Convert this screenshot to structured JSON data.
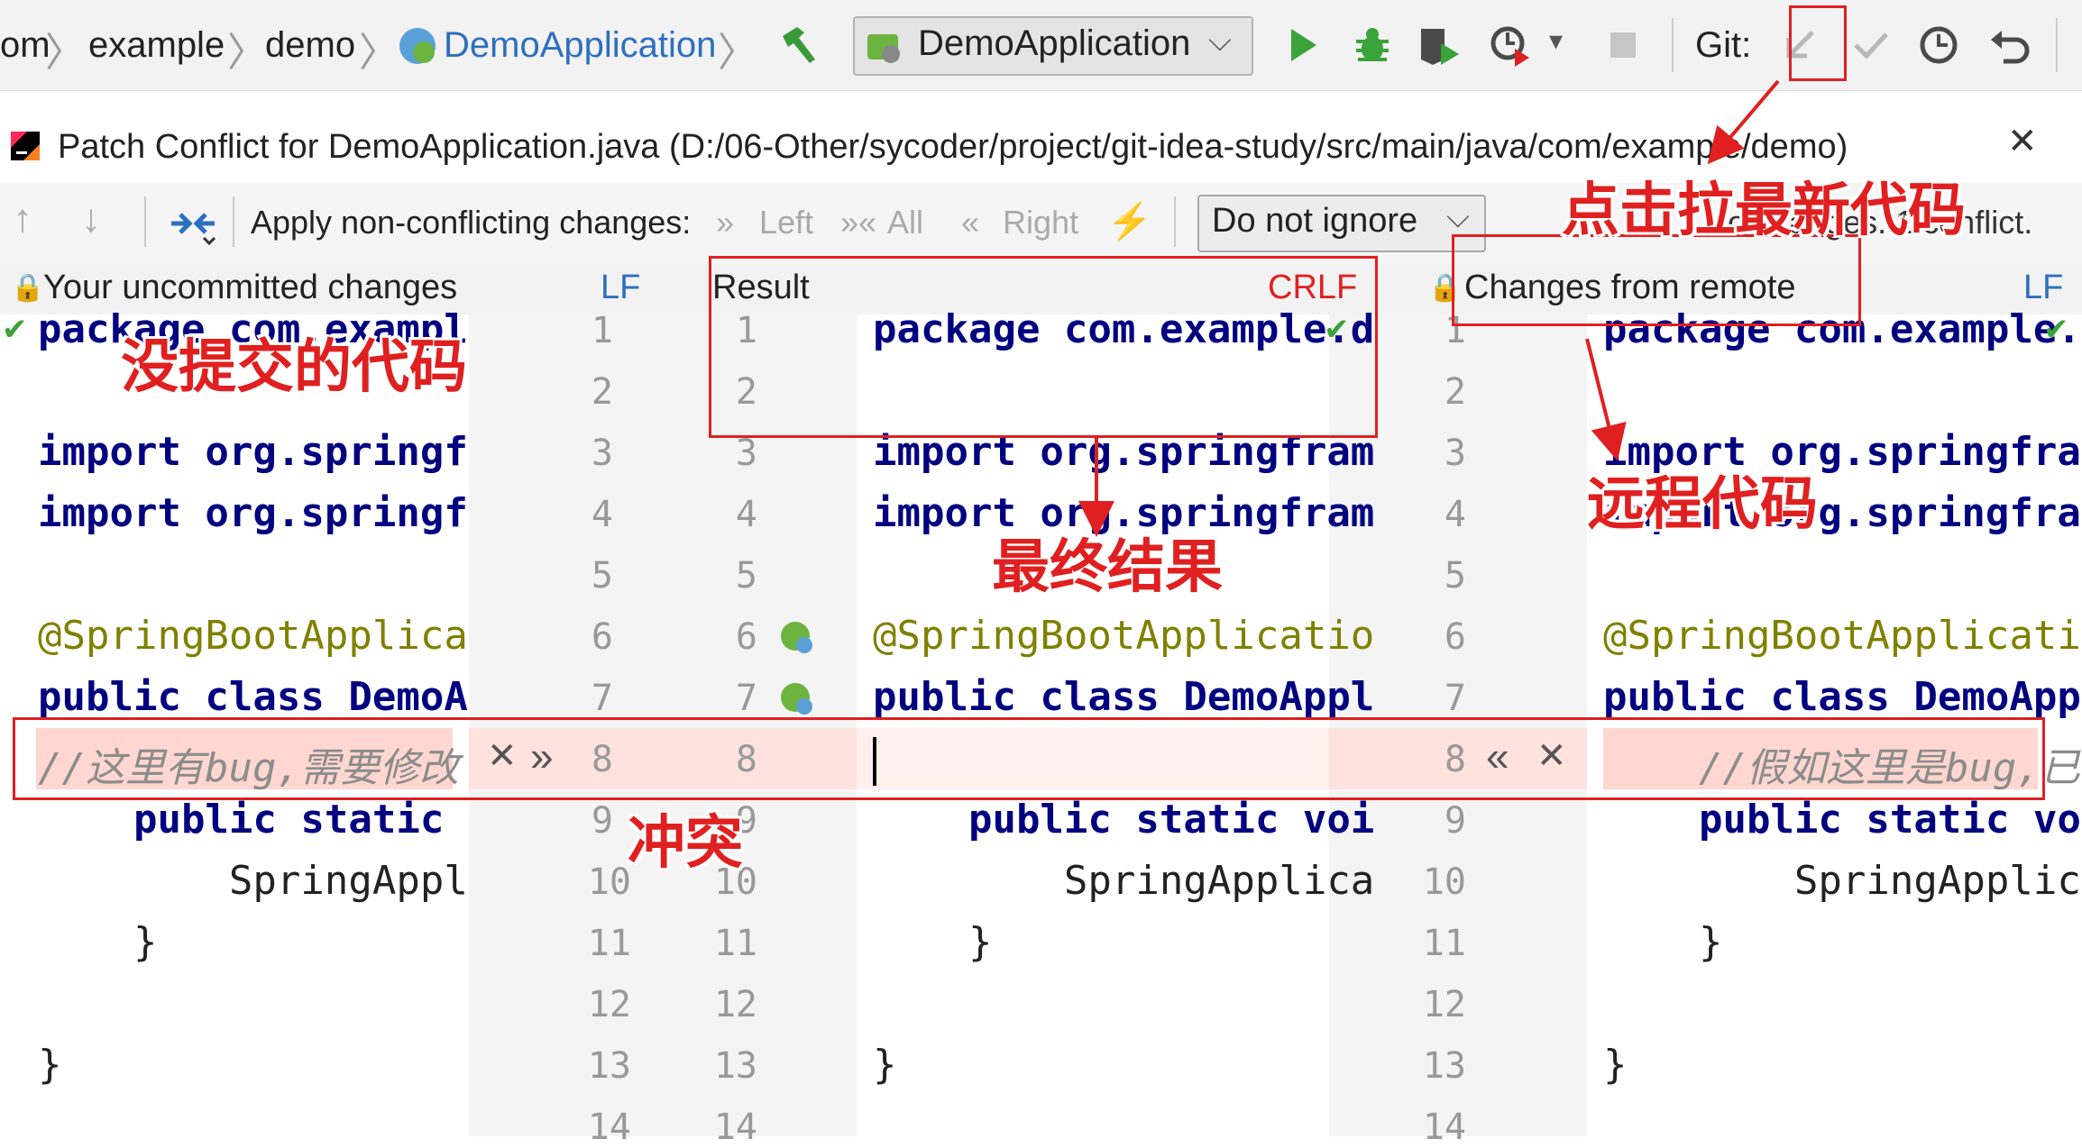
{
  "breadcrumb": {
    "items": [
      "om",
      "example",
      "demo",
      "DemoApplication"
    ]
  },
  "toolbar": {
    "run_config": "DemoApplication",
    "git_label": "Git:"
  },
  "dialog": {
    "title": "Patch Conflict for DemoApplication.java (D:/06-Other/sycoder/project/git-idea-study/src/main/java/com/example/demo)",
    "apply_label": "Apply non-conflicting changes:",
    "apply_left": "Left",
    "apply_all": "All",
    "apply_right": "Right",
    "ignore_select": "Do not ignore",
    "status": "No changes. 1 conflict."
  },
  "panes": {
    "left_title": "Your uncommitted changes",
    "left_eol": "LF",
    "result_title": "Result",
    "result_eol": "CRLF",
    "right_title": "Changes from remote",
    "right_eol": "LF"
  },
  "code": {
    "left": [
      "package com.exampl",
      "",
      "import org.springf",
      "import org.springf",
      "",
      "@SpringBootApplica",
      "public class DemoA",
      "//这里有bug,需要修改",
      "    public static",
      "        SpringAppl",
      "    }",
      "",
      "}"
    ],
    "result": [
      "package com.example.d",
      "",
      "import org.springfram",
      "import org.springfram",
      "",
      "@SpringBootApplicatio",
      "public class DemoAppl",
      "",
      "    public static voi",
      "        SpringApplica",
      "    }",
      "",
      "}"
    ],
    "right": [
      "package com.example.",
      "",
      "import org.springfra",
      "import org.springfra",
      "",
      "@SpringBootApplicati",
      "public class DemoApp",
      "    //假如这里是bug,已",
      "    public static vo",
      "        SpringApplic",
      "    }",
      "",
      "}"
    ],
    "line_numbers": [
      "1",
      "2",
      "3",
      "4",
      "5",
      "6",
      "7",
      "8",
      "9",
      "10",
      "11",
      "12",
      "13",
      "14"
    ]
  },
  "annotations": {
    "pull": "点击拉最新代码",
    "uncommitted": "没提交的代码",
    "result": "最终结果",
    "remote": "远程代码",
    "conflict": "冲突"
  },
  "colors": {
    "annotation_red": "#e02020",
    "conflict_bg": "#ffd6d0",
    "keyword": "#000080",
    "annotation": "#808000"
  }
}
